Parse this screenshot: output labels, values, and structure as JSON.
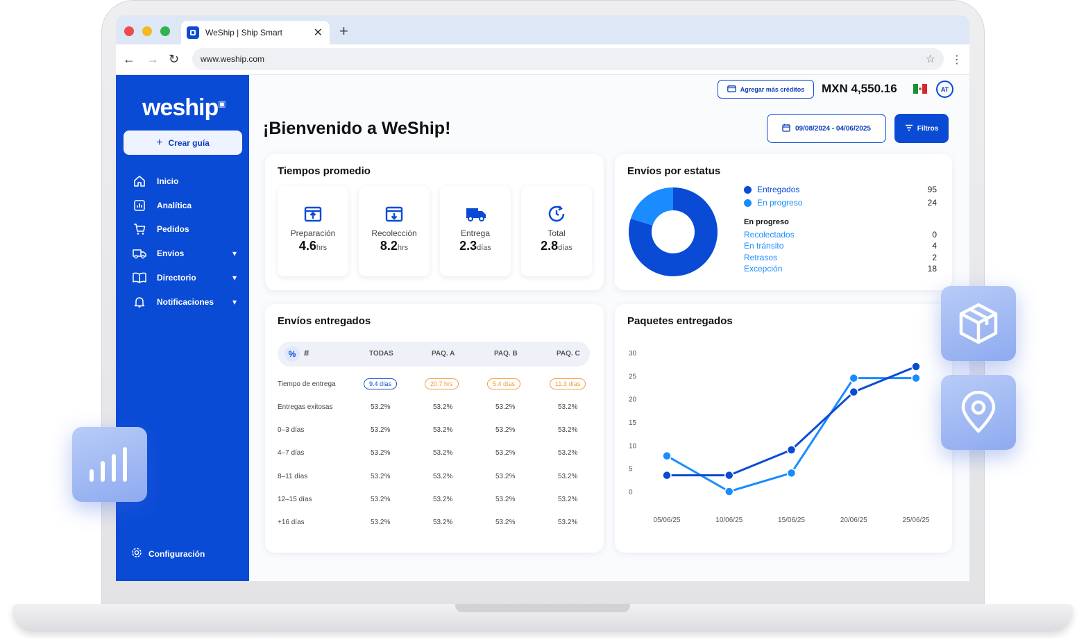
{
  "browser": {
    "tab_title": "WeShip | Ship Smart",
    "close_glyph": "✕",
    "new_tab_glyph": "+",
    "url": "www.weship.com",
    "back_glyph": "←",
    "forward_glyph": "→",
    "reload_glyph": "↻",
    "star_glyph": "☆",
    "menu_glyph": "⋮",
    "traffic_lights": [
      "#ee4c4c",
      "#f5b81f",
      "#2fb34a"
    ]
  },
  "sidebar": {
    "logo": "weship",
    "create_label": "Crear guía",
    "items": [
      {
        "label": "Inicio",
        "icon": "home-icon"
      },
      {
        "label": "Analítica",
        "icon": "analytics-icon"
      },
      {
        "label": "Pedidos",
        "icon": "cart-icon"
      },
      {
        "label": "Envios",
        "icon": "truck-icon",
        "expandable": true
      },
      {
        "label": "Directorio",
        "icon": "book-icon",
        "expandable": true
      },
      {
        "label": "Notificaciones",
        "icon": "bell-icon",
        "expandable": true
      }
    ],
    "config_label": "Configuración"
  },
  "header": {
    "credits_label": "Agregar más créditos",
    "balance": "MXN 4,550.16",
    "avatar_initials": "AT",
    "welcome": "¡Bienvenido a WeShip!",
    "date_range": "09/08/2024 - 04/06/2025",
    "filters_label": "Filtros"
  },
  "avg_times": {
    "title": "Tiempos promedio",
    "metrics": [
      {
        "label": "Preparación",
        "value": "4.6",
        "unit": "hrs"
      },
      {
        "label": "Recolección",
        "value": "8.2",
        "unit": "hrs"
      },
      {
        "label": "Entrega",
        "value": "2.3",
        "unit": "días"
      },
      {
        "label": "Total",
        "value": "2.8",
        "unit": "días"
      }
    ]
  },
  "status": {
    "title": "Envíos por estatus",
    "legend": [
      {
        "label": "Entregados",
        "value": "95",
        "color": "#0a4bd6"
      },
      {
        "label": "En progreso",
        "value": "24",
        "color": "#1a8cff"
      }
    ],
    "sub_title": "En progreso",
    "sub_items": [
      {
        "label": "Recolectados",
        "value": "0"
      },
      {
        "label": "En tránsito",
        "value": "4"
      },
      {
        "label": "Retrasos",
        "value": "2"
      },
      {
        "label": "Excepción",
        "value": "18"
      }
    ]
  },
  "delivered": {
    "title": "Envíos entregados",
    "toggle_percent": "%",
    "toggle_count": "#",
    "columns": [
      "TODAS",
      "PAQ. A",
      "PAQ. B",
      "PAQ. C"
    ],
    "time_row": {
      "label": "Tiempo de entrega",
      "values": [
        "9.4 días",
        "20.7 hrs",
        "5.4 días",
        "11.3 días"
      ]
    },
    "rows": [
      {
        "label": "Entregas exitosas",
        "values": [
          "53.2%",
          "53.2%",
          "53.2%",
          "53.2%"
        ]
      },
      {
        "label": "0–3 días",
        "values": [
          "53.2%",
          "53.2%",
          "53.2%",
          "53.2%"
        ]
      },
      {
        "label": "4–7 días",
        "values": [
          "53.2%",
          "53.2%",
          "53.2%",
          "53.2%"
        ]
      },
      {
        "label": "8–11 días",
        "values": [
          "53.2%",
          "53.2%",
          "53.2%",
          "53.2%"
        ]
      },
      {
        "label": "12–15 días",
        "values": [
          "53.2%",
          "53.2%",
          "53.2%",
          "53.2%"
        ]
      },
      {
        "label": "+16 días",
        "values": [
          "53.2%",
          "53.2%",
          "53.2%",
          "53.2%"
        ]
      }
    ]
  },
  "packages": {
    "title": "Paquetes entregados"
  },
  "chart_data": [
    {
      "type": "pie",
      "donut": true,
      "slices": [
        {
          "label": "Entregados",
          "value": 95,
          "color": "#0a4bd6"
        },
        {
          "label": "En progreso",
          "value": 24,
          "color": "#1a8cff"
        }
      ]
    },
    {
      "type": "line",
      "x": [
        "05/06/25",
        "10/06/25",
        "15/06/25",
        "20/06/25",
        "25/06/25"
      ],
      "ylim": [
        0,
        30
      ],
      "yticks": [
        0,
        5,
        10,
        15,
        20,
        25,
        30
      ],
      "grid": false,
      "series": [
        {
          "values": [
            3.5,
            3.5,
            9,
            21.5,
            27
          ],
          "color": "#0a4bd6"
        },
        {
          "values": [
            7.7,
            0,
            4,
            24.5,
            24.5
          ],
          "color": "#1a8cff"
        }
      ]
    }
  ]
}
